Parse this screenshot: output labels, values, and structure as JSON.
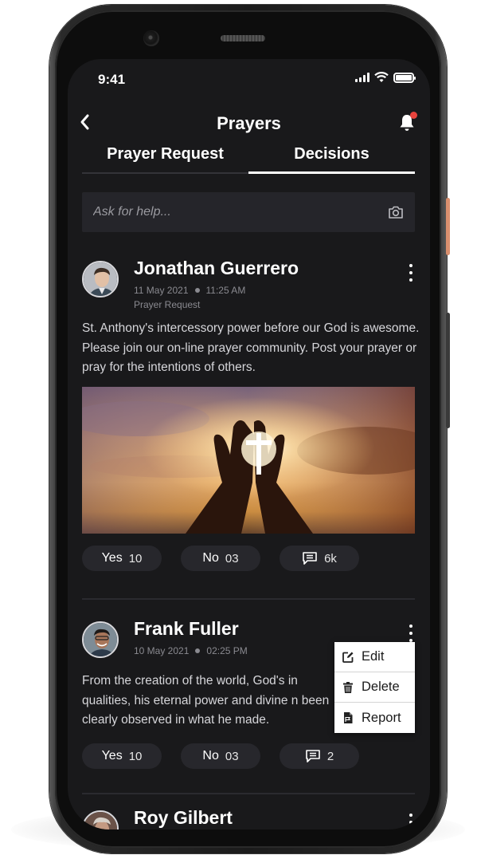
{
  "status_bar": {
    "time": "9:41"
  },
  "header": {
    "title": "Prayers",
    "back_icon": "chevron-left-icon",
    "notification_icon": "bell-icon",
    "has_notification": true
  },
  "tabs": [
    {
      "label": "Prayer Request",
      "active": false
    },
    {
      "label": "Decisions",
      "active": true
    }
  ],
  "search": {
    "placeholder": "Ask for help...",
    "value": "",
    "icon": "camera-icon"
  },
  "posts": [
    {
      "author": "Jonathan Guerrero",
      "date": "11 May 2021",
      "time": "11:25 AM",
      "category": "Prayer Request",
      "body": "St. Anthony's intercessory power before our God is awesome.  Please join our on-line prayer community.  Post your prayer or pray for the intentions of others.",
      "image": "praying-hands-with-cross-at-sunset",
      "actions": {
        "yes_label": "Yes",
        "yes_count": "10",
        "no_label": "No",
        "no_count": "03",
        "comments_count": "6k"
      }
    },
    {
      "author": "Frank Fuller",
      "date": "10 May 2021",
      "time": "02:25 PM",
      "body": "From the creation of the world, God's in qualities, his eternal power and divine n been clearly observed in what he made.",
      "actions": {
        "yes_label": "Yes",
        "yes_count": "10",
        "no_label": "No",
        "no_count": "03",
        "comments_count": "2"
      }
    },
    {
      "author": "Roy Gilbert"
    }
  ],
  "context_menu": {
    "items": [
      {
        "label": "Edit",
        "icon": "edit-icon"
      },
      {
        "label": "Delete",
        "icon": "trash-icon"
      },
      {
        "label": "Report",
        "icon": "report-icon"
      }
    ]
  },
  "colors": {
    "background": "#19191b",
    "surface": "#27272c",
    "accent_notification": "#e8433d",
    "side_button": "#d98f6e"
  }
}
